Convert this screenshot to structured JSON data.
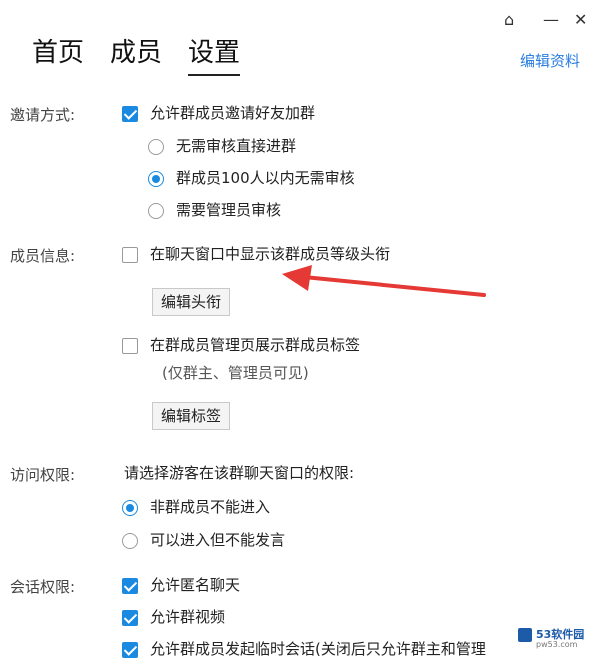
{
  "window_controls": {
    "skin_icon": "⌂",
    "min_icon": "—",
    "close_icon": "✕"
  },
  "tabs": [
    {
      "label": "首页"
    },
    {
      "label": "成员"
    },
    {
      "label": "设置"
    }
  ],
  "edit_profile": "编辑资料",
  "invite": {
    "section_label": "邀请方式:",
    "allow_invite": {
      "label": "允许群成员邀请好友加群",
      "checked": true
    },
    "options": [
      {
        "label": "无需审核直接进群",
        "selected": false
      },
      {
        "label": "群成员100人以内无需审核",
        "selected": true
      },
      {
        "label": "需要管理员审核",
        "selected": false
      }
    ]
  },
  "member_info": {
    "section_label": "成员信息:",
    "show_title": {
      "label": "在聊天窗口中显示该群成员等级头衔",
      "checked": false
    },
    "edit_title_button": "编辑头衔",
    "show_tags": {
      "label": "在群成员管理页展示群成员标签",
      "checked": false
    },
    "tags_note": "(仅群主、管理员可见)",
    "edit_tags_button": "编辑标签"
  },
  "access": {
    "section_label": "访问权限:",
    "prompt": "请选择游客在该群聊天窗口的权限:",
    "options": [
      {
        "label": "非群成员不能进入",
        "selected": true
      },
      {
        "label": "可以进入但不能发言",
        "selected": false
      }
    ]
  },
  "session": {
    "section_label": "会话权限:",
    "options": [
      {
        "label": "允许匿名聊天",
        "checked": true
      },
      {
        "label": "允许群视频",
        "checked": true
      },
      {
        "label": "允许群成员发起临时会话(关闭后只允许群主和管理",
        "checked": true
      }
    ]
  },
  "watermark": {
    "text": "53软件园",
    "subtext": "pw53.com"
  },
  "colors": {
    "accent": "#1a8ae0",
    "link": "#2a7ee0",
    "annotation_arrow": "#e53935"
  }
}
